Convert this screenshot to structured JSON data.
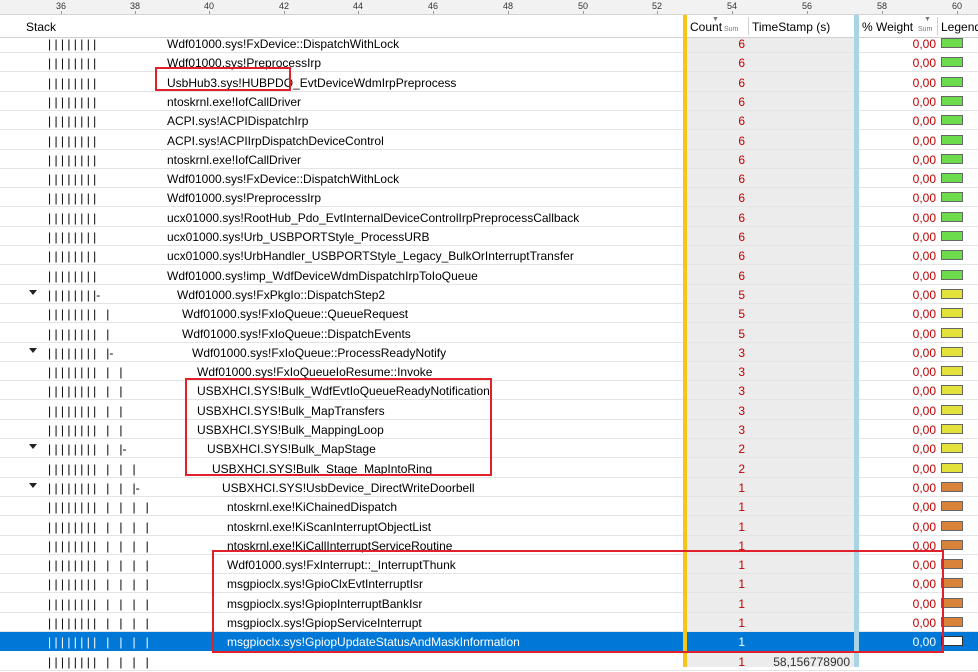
{
  "ruler": {
    "ticks": [
      "36",
      "38",
      "40",
      "42",
      "44",
      "46",
      "48",
      "50",
      "52",
      "54",
      "56",
      "58",
      "60"
    ]
  },
  "columns": {
    "stack": "Stack",
    "count": "Count",
    "count_sum": "Sum",
    "timestamp": "TimeStamp (s)",
    "weight": "% Weight",
    "weight_sum": "Sum",
    "legend": "Legend"
  },
  "colors": {
    "green": "#6ddc4c",
    "yellow": "#e2e23a",
    "orange": "#d9833a",
    "gold": "#f5c518",
    "lightblue": "#a8d4e6",
    "red_box": "#e0202a"
  },
  "rows": [
    {
      "tree": "| | | | | | | |",
      "name": "Wdf01000.sys!FxDevice::DispatchWithLock",
      "count": "6",
      "timestamp": "",
      "weight": "0,00",
      "legend": "green"
    },
    {
      "tree": "| | | | | | | |",
      "name": "Wdf01000.sys!PreprocessIrp",
      "count": "6",
      "timestamp": "",
      "weight": "0,00",
      "legend": "green"
    },
    {
      "tree": "| | | | | | | |",
      "name": "UsbHub3.sys!HUBPDO_EvtDeviceWdmIrpPreprocess",
      "count": "6",
      "timestamp": "",
      "weight": "0,00",
      "legend": "green"
    },
    {
      "tree": "| | | | | | | |",
      "name": "ntoskrnl.exe!IofCallDriver",
      "count": "6",
      "timestamp": "",
      "weight": "0,00",
      "legend": "green"
    },
    {
      "tree": "| | | | | | | |",
      "name": "ACPI.sys!ACPIDispatchIrp",
      "count": "6",
      "timestamp": "",
      "weight": "0,00",
      "legend": "green"
    },
    {
      "tree": "| | | | | | | |",
      "name": "ACPI.sys!ACPIIrpDispatchDeviceControl",
      "count": "6",
      "timestamp": "",
      "weight": "0,00",
      "legend": "green"
    },
    {
      "tree": "| | | | | | | |",
      "name": "ntoskrnl.exe!IofCallDriver",
      "count": "6",
      "timestamp": "",
      "weight": "0,00",
      "legend": "green"
    },
    {
      "tree": "| | | | | | | |",
      "name": "Wdf01000.sys!FxDevice::DispatchWithLock",
      "count": "6",
      "timestamp": "",
      "weight": "0,00",
      "legend": "green"
    },
    {
      "tree": "| | | | | | | |",
      "name": "Wdf01000.sys!PreprocessIrp",
      "count": "6",
      "timestamp": "",
      "weight": "0,00",
      "legend": "green"
    },
    {
      "tree": "| | | | | | | |",
      "name": "ucx01000.sys!RootHub_Pdo_EvtInternalDeviceControlIrpPreprocessCallback",
      "count": "6",
      "timestamp": "",
      "weight": "0,00",
      "legend": "green"
    },
    {
      "tree": "| | | | | | | |",
      "name": "ucx01000.sys!Urb_USBPORTStyle_ProcessURB",
      "count": "6",
      "timestamp": "",
      "weight": "0,00",
      "legend": "green"
    },
    {
      "tree": "| | | | | | | |",
      "name": "ucx01000.sys!UrbHandler_USBPORTStyle_Legacy_BulkOrInterruptTransfer",
      "count": "6",
      "timestamp": "",
      "weight": "0,00",
      "legend": "green"
    },
    {
      "tree": "| | | | | | | |",
      "name": "Wdf01000.sys!imp_WdfDeviceWdmDispatchIrpToIoQueue",
      "count": "6",
      "timestamp": "",
      "weight": "0,00",
      "legend": "green"
    },
    {
      "tree": "| | | | | | | |-",
      "name": "Wdf01000.sys!FxPkgIo::DispatchStep2",
      "count": "5",
      "timestamp": "",
      "weight": "0,00",
      "legend": "yellow",
      "expander": true
    },
    {
      "tree": "| | | | | | | |   |",
      "name": "Wdf01000.sys!FxIoQueue::QueueRequest",
      "count": "5",
      "timestamp": "",
      "weight": "0,00",
      "legend": "yellow"
    },
    {
      "tree": "| | | | | | | |   |",
      "name": "Wdf01000.sys!FxIoQueue::DispatchEvents",
      "count": "5",
      "timestamp": "",
      "weight": "0,00",
      "legend": "yellow"
    },
    {
      "tree": "| | | | | | | |   |-",
      "name": "Wdf01000.sys!FxIoQueue::ProcessReadyNotify",
      "count": "3",
      "timestamp": "",
      "weight": "0,00",
      "legend": "yellow",
      "expander": true
    },
    {
      "tree": "| | | | | | | |   |   |",
      "name": "Wdf01000.sys!FxIoQueueIoResume::Invoke",
      "count": "3",
      "timestamp": "",
      "weight": "0,00",
      "legend": "yellow"
    },
    {
      "tree": "| | | | | | | |   |   |",
      "name": "USBXHCI.SYS!Bulk_WdfEvtIoQueueReadyNotification",
      "count": "3",
      "timestamp": "",
      "weight": "0,00",
      "legend": "yellow"
    },
    {
      "tree": "| | | | | | | |   |   |",
      "name": "USBXHCI.SYS!Bulk_MapTransfers",
      "count": "3",
      "timestamp": "",
      "weight": "0,00",
      "legend": "yellow"
    },
    {
      "tree": "| | | | | | | |   |   |",
      "name": "USBXHCI.SYS!Bulk_MappingLoop",
      "count": "3",
      "timestamp": "",
      "weight": "0,00",
      "legend": "yellow"
    },
    {
      "tree": "| | | | | | | |   |   |-",
      "name": "USBXHCI.SYS!Bulk_MapStage",
      "count": "2",
      "timestamp": "",
      "weight": "0,00",
      "legend": "yellow",
      "expander": true
    },
    {
      "tree": "| | | | | | | |   |   |   |",
      "name": "USBXHCI.SYS!Bulk_Stage_MapIntoRing",
      "count": "2",
      "timestamp": "",
      "weight": "0,00",
      "legend": "yellow"
    },
    {
      "tree": "| | | | | | | |   |   |   |-",
      "name": "USBXHCI.SYS!UsbDevice_DirectWriteDoorbell",
      "count": "1",
      "timestamp": "",
      "weight": "0,00",
      "legend": "orange",
      "expander": true
    },
    {
      "tree": "| | | | | | | |   |   |   |   |",
      "name": "ntoskrnl.exe!KiChainedDispatch",
      "count": "1",
      "timestamp": "",
      "weight": "0,00",
      "legend": "orange"
    },
    {
      "tree": "| | | | | | | |   |   |   |   |",
      "name": "ntoskrnl.exe!KiScanInterruptObjectList",
      "count": "1",
      "timestamp": "",
      "weight": "0,00",
      "legend": "orange"
    },
    {
      "tree": "| | | | | | | |   |   |   |   |",
      "name": "ntoskrnl.exe!KiCallInterruptServiceRoutine",
      "count": "1",
      "timestamp": "",
      "weight": "0,00",
      "legend": "orange"
    },
    {
      "tree": "| | | | | | | |   |   |   |   |",
      "name": "Wdf01000.sys!FxInterrupt::_InterruptThunk",
      "count": "1",
      "timestamp": "",
      "weight": "0,00",
      "legend": "orange"
    },
    {
      "tree": "| | | | | | | |   |   |   |   |",
      "name": "msgpioclx.sys!GpioClxEvtInterruptIsr",
      "count": "1",
      "timestamp": "",
      "weight": "0,00",
      "legend": "orange"
    },
    {
      "tree": "| | | | | | | |   |   |   |   |",
      "name": "msgpioclx.sys!GpiopInterruptBankIsr",
      "count": "1",
      "timestamp": "",
      "weight": "0,00",
      "legend": "orange"
    },
    {
      "tree": "| | | | | | | |   |   |   |   |",
      "name": "msgpioclx.sys!GpiopServiceInterrupt",
      "count": "1",
      "timestamp": "",
      "weight": "0,00",
      "legend": "orange"
    },
    {
      "tree": "| | | | | | | |   |   |   |   |",
      "name": "msgpioclx.sys!GpiopUpdateStatusAndMaskInformation",
      "count": "1",
      "timestamp": "",
      "weight": "0,00",
      "legend": "orange",
      "selected": true
    },
    {
      "tree": "| | | | | | | |   |   |   |   |",
      "name": "",
      "count": "1",
      "timestamp": "58,156778900",
      "weight": "",
      "legend": ""
    }
  ]
}
